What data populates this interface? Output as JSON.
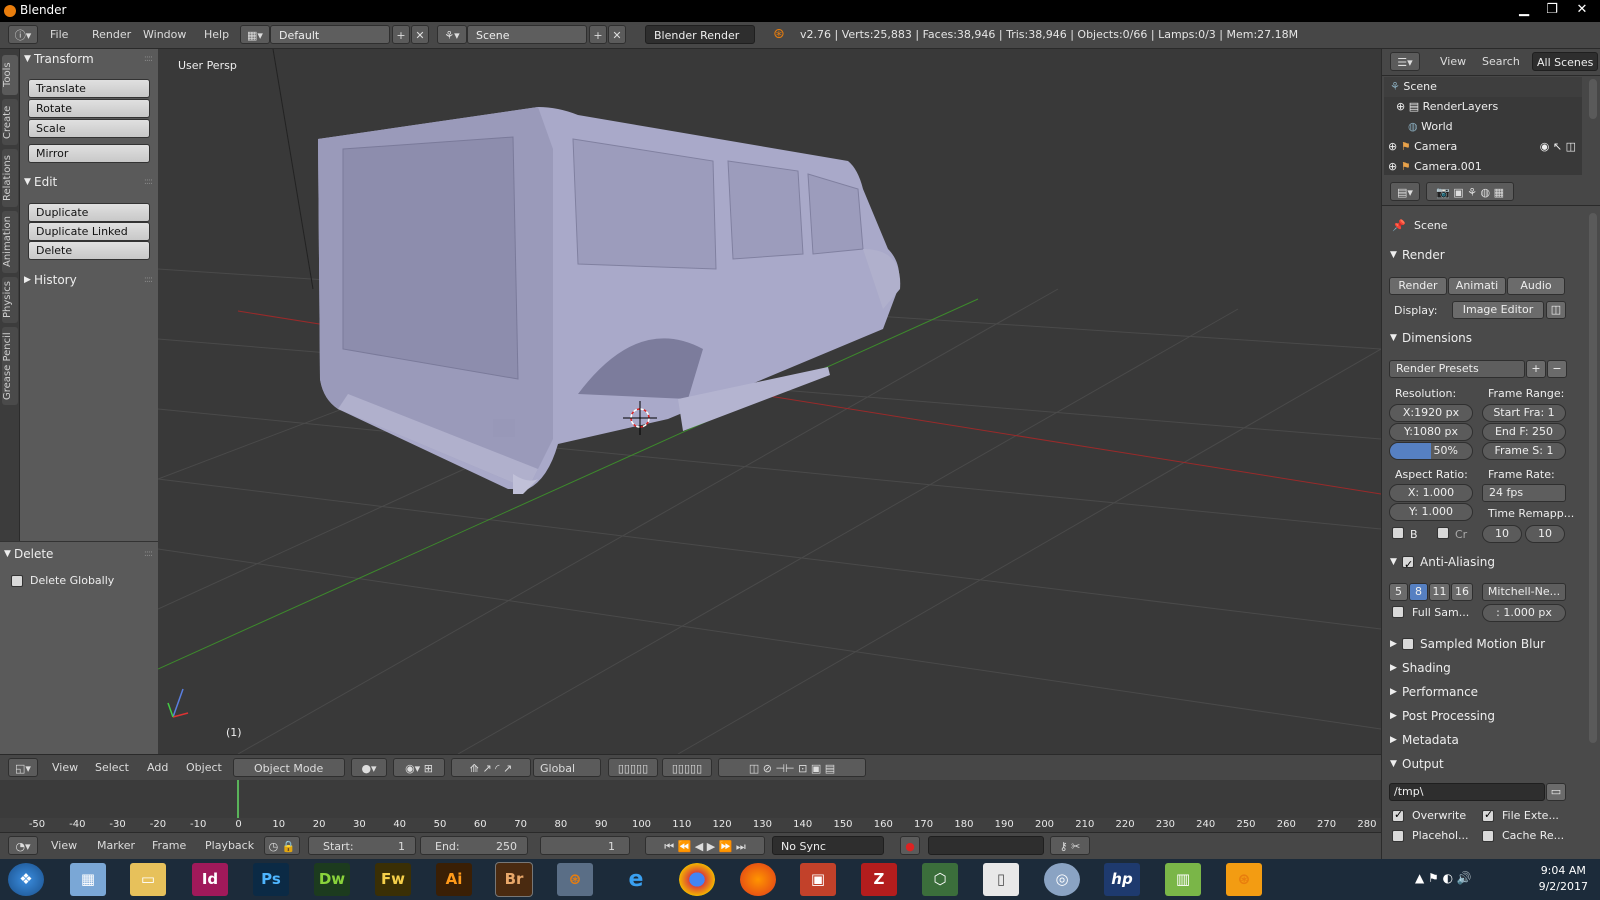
{
  "titlebar": {
    "title": "Blender",
    "minimize": "▁",
    "maximize": "❐",
    "close": "✕"
  },
  "infobar": {
    "menus": [
      "File",
      "Render",
      "Window",
      "Help"
    ],
    "layout": "Default",
    "scene": "Scene",
    "engine": "Blender Render",
    "stats": "v2.76 | Verts:25,883 | Faces:38,946 | Tris:38,946 | Objects:0/66 | Lamps:0/3 | Mem:27.18M"
  },
  "tabs": [
    "Tools",
    "Create",
    "Relations",
    "Animation",
    "Physics",
    "Grease Pencil"
  ],
  "toolshelf": {
    "transform": {
      "title": "Transform",
      "buttons": [
        "Translate",
        "Rotate",
        "Scale"
      ],
      "mirror": "Mirror"
    },
    "edit": {
      "title": "Edit",
      "buttons": [
        "Duplicate",
        "Duplicate Linked",
        "Delete"
      ]
    },
    "history": {
      "title": "History"
    }
  },
  "redo": {
    "title": "Delete",
    "option": "Delete Globally"
  },
  "viewport": {
    "label": "User Persp",
    "frame": "(1)"
  },
  "view3d_header": {
    "menus": [
      "View",
      "Select",
      "Add",
      "Object"
    ],
    "mode": "Object Mode",
    "orientation": "Global"
  },
  "timeline": {
    "ticks": [
      "-50",
      "-40",
      "-30",
      "-20",
      "-10",
      "0",
      "10",
      "20",
      "30",
      "40",
      "50",
      "60",
      "70",
      "80",
      "90",
      "100",
      "110",
      "120",
      "130",
      "140",
      "150",
      "160",
      "170",
      "180",
      "190",
      "200",
      "210",
      "220",
      "230",
      "240",
      "250",
      "260",
      "270",
      "280"
    ],
    "current_frame": 1
  },
  "playback_header": {
    "menus": [
      "View",
      "Marker",
      "Frame",
      "Playback"
    ],
    "start": "Start:",
    "start_val": "1",
    "end": "End:",
    "end_val": "250",
    "current": "1",
    "sync": "No Sync"
  },
  "outliner": {
    "menus": [
      "View",
      "Search"
    ],
    "filter": "All Scenes",
    "rows": [
      "Scene",
      "RenderLayers",
      "World",
      "Camera",
      "Camera.001"
    ]
  },
  "properties": {
    "context": "Scene",
    "render": {
      "title": "Render",
      "buttons": [
        "Render",
        "Animati",
        "Audio"
      ],
      "display_label": "Display:",
      "display_value": "Image Editor"
    },
    "dimensions": {
      "title": "Dimensions",
      "presets": "Render Presets",
      "resolution_label": "Resolution:",
      "res_x": "X:1920 px",
      "res_y": "Y:1080 px",
      "res_pct": "50%",
      "frame_range_label": "Frame Range:",
      "start": "Start Fra: 1",
      "end": "End F: 250",
      "step": "Frame S: 1",
      "aspect_label": "Aspect Ratio:",
      "aspect_x": "X:    1.000",
      "aspect_y": "Y:    1.000",
      "frame_rate_label": "Frame Rate:",
      "fps": "24 fps",
      "remap_label": "Time Remapp...",
      "remap_old": "10",
      "remap_new": "10",
      "border": "B",
      "crop": "Cr"
    },
    "aa": {
      "title": "Anti-Aliasing",
      "samples": [
        "5",
        "8",
        "11",
        "16"
      ],
      "filter": "Mitchell-Ne...",
      "full_sample": "Full Sam...",
      "size": ": 1.000 px"
    },
    "sections": [
      "Sampled Motion Blur",
      "Shading",
      "Performance",
      "Post Processing",
      "Metadata"
    ],
    "output": {
      "title": "Output",
      "path": "/tmp\\",
      "overwrite": "Overwrite",
      "file_ext": "File Exte...",
      "placeholders": "Placehol...",
      "cache": "Cache Re..."
    }
  },
  "taskbar": {
    "apps": [
      "Id",
      "Ps",
      "Dw",
      "Fw",
      "Ai",
      "Br"
    ],
    "time": "9:04 AM",
    "date": "9/2/2017"
  },
  "colors": {
    "accent": "#5680c2",
    "blender_orange": "#e87d0d",
    "grid_x": "#9a2a2a",
    "grid_y": "#3d8a2c"
  }
}
